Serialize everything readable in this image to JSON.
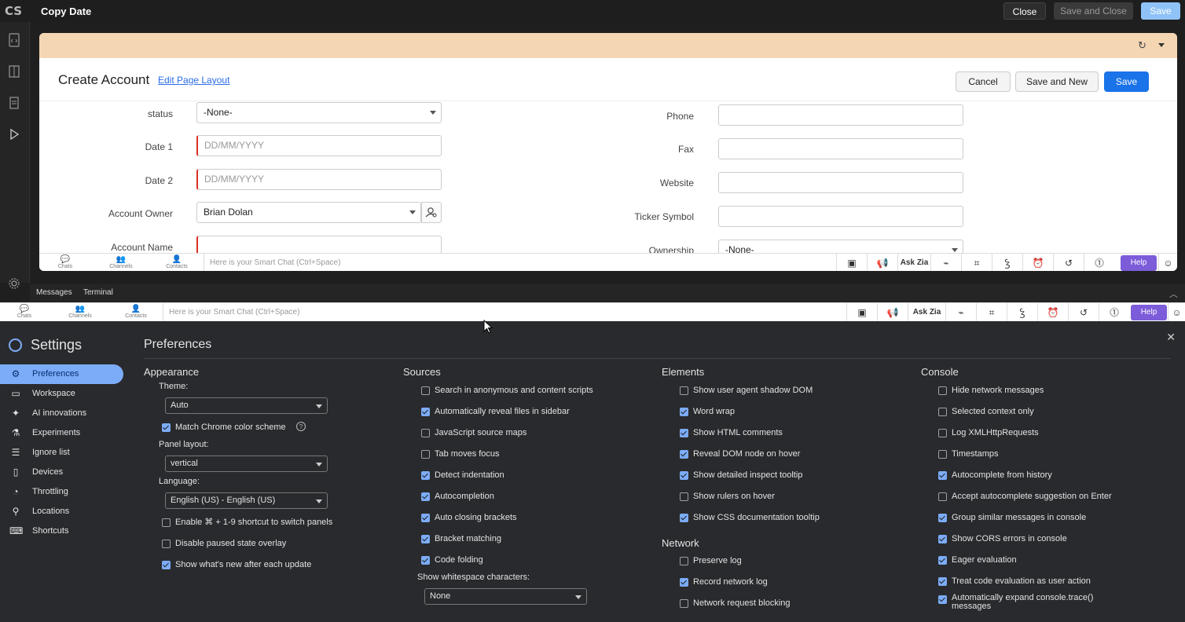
{
  "app": {
    "logo": "CS",
    "title": "Copy Date",
    "close_label": "Close",
    "save_close_label": "Save and Close",
    "save_label": "Save"
  },
  "panel": {
    "title": "Create Account",
    "edit_link": "Edit Page Layout",
    "cancel_label": "Cancel",
    "save_new_label": "Save and New",
    "save_label": "Save",
    "left_fields": [
      {
        "label": "status",
        "value": "-None-",
        "placeholder": ""
      },
      {
        "label": "Date 1",
        "value": "",
        "placeholder": "DD/MM/YYYY"
      },
      {
        "label": "Date 2",
        "value": "",
        "placeholder": "DD/MM/YYYY"
      },
      {
        "label": "Account Owner",
        "value": "Brian Dolan",
        "placeholder": ""
      },
      {
        "label": "Account Name",
        "value": "",
        "placeholder": ""
      }
    ],
    "right_fields": [
      {
        "label": "Phone",
        "value": ""
      },
      {
        "label": "Fax",
        "value": ""
      },
      {
        "label": "Website",
        "value": ""
      },
      {
        "label": "Ticker Symbol",
        "value": ""
      },
      {
        "label": "Ownership",
        "value": "-None-"
      }
    ]
  },
  "chatbar": {
    "chats": "Chats",
    "channels": "Channels",
    "contacts": "Contacts",
    "placeholder": "Here is your Smart Chat (Ctrl+Space)",
    "ask_zia": "Ask Zia",
    "help": "Help"
  },
  "bottom_tabs": {
    "messages": "Messages",
    "terminal": "Terminal"
  },
  "settings": {
    "title": "Settings",
    "nav": [
      "Preferences",
      "Workspace",
      "AI innovations",
      "Experiments",
      "Ignore list",
      "Devices",
      "Throttling",
      "Locations",
      "Shortcuts"
    ],
    "page_title": "Preferences",
    "appearance": {
      "heading": "Appearance",
      "theme_label": "Theme:",
      "theme_value": "Auto",
      "match_chrome": "Match Chrome color scheme",
      "panel_layout_label": "Panel layout:",
      "panel_layout_value": "vertical",
      "language_label": "Language:",
      "language_value": "English (US) - English (US)",
      "shortcut_switch": "Enable ⌘ + 1-9 shortcut to switch panels",
      "disable_paused": "Disable paused state overlay",
      "whats_new": "Show what's new after each update"
    },
    "sources": {
      "heading": "Sources",
      "items": [
        {
          "label": "Search in anonymous and content scripts",
          "checked": false
        },
        {
          "label": "Automatically reveal files in sidebar",
          "checked": true
        },
        {
          "label": "JavaScript source maps",
          "checked": false
        },
        {
          "label": "Tab moves focus",
          "checked": false
        },
        {
          "label": "Detect indentation",
          "checked": true
        },
        {
          "label": "Autocompletion",
          "checked": true
        },
        {
          "label": "Auto closing brackets",
          "checked": true
        },
        {
          "label": "Bracket matching",
          "checked": true
        },
        {
          "label": "Code folding",
          "checked": true
        }
      ],
      "whitespace_label": "Show whitespace characters:",
      "whitespace_value": "None"
    },
    "elements": {
      "heading": "Elements",
      "items": [
        {
          "label": "Show user agent shadow DOM",
          "checked": false
        },
        {
          "label": "Word wrap",
          "checked": true
        },
        {
          "label": "Show HTML comments",
          "checked": true
        },
        {
          "label": "Reveal DOM node on hover",
          "checked": true
        },
        {
          "label": "Show detailed inspect tooltip",
          "checked": true
        },
        {
          "label": "Show rulers on hover",
          "checked": false
        },
        {
          "label": "Show CSS documentation tooltip",
          "checked": true
        }
      ]
    },
    "network": {
      "heading": "Network",
      "items": [
        {
          "label": "Preserve log",
          "checked": false
        },
        {
          "label": "Record network log",
          "checked": true
        },
        {
          "label": "Network request blocking",
          "checked": false
        }
      ]
    },
    "console": {
      "heading": "Console",
      "items": [
        {
          "label": "Hide network messages",
          "checked": false
        },
        {
          "label": "Selected context only",
          "checked": false
        },
        {
          "label": "Log XMLHttpRequests",
          "checked": false
        },
        {
          "label": "Timestamps",
          "checked": false
        },
        {
          "label": "Autocomplete from history",
          "checked": true
        },
        {
          "label": "Accept autocomplete suggestion on Enter",
          "checked": false
        },
        {
          "label": "Group similar messages in console",
          "checked": true
        },
        {
          "label": "Show CORS errors in console",
          "checked": true
        },
        {
          "label": "Eager evaluation",
          "checked": true
        },
        {
          "label": "Treat code evaluation as user action",
          "checked": true
        },
        {
          "label": "Automatically expand console.trace() messages",
          "checked": true
        }
      ]
    }
  }
}
